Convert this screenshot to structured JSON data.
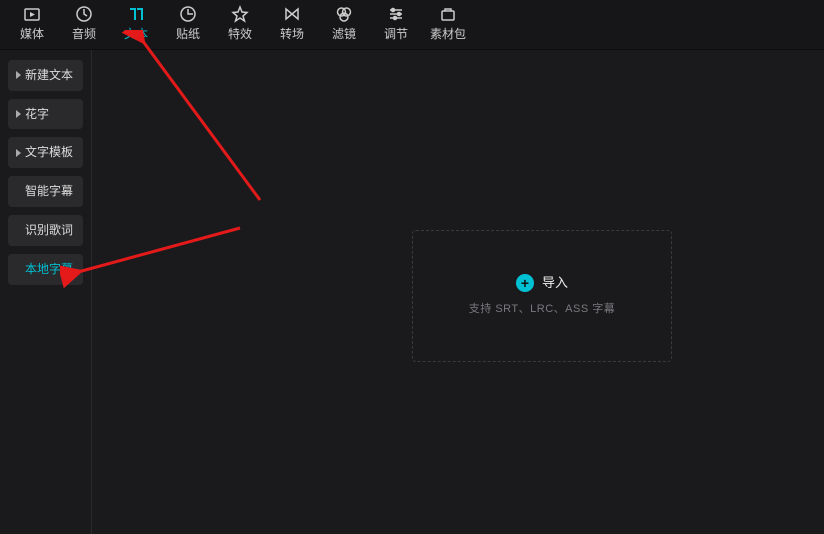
{
  "toolbar": [
    {
      "id": "media",
      "label": "媒体"
    },
    {
      "id": "audio",
      "label": "音频"
    },
    {
      "id": "text",
      "label": "文本",
      "active": true
    },
    {
      "id": "sticker",
      "label": "贴纸"
    },
    {
      "id": "effect",
      "label": "特效"
    },
    {
      "id": "transition",
      "label": "转场"
    },
    {
      "id": "filter",
      "label": "滤镜"
    },
    {
      "id": "adjust",
      "label": "调节"
    },
    {
      "id": "assets",
      "label": "素材包"
    }
  ],
  "sidebar": [
    {
      "id": "new-text",
      "label": "新建文本",
      "caret": true
    },
    {
      "id": "fancy-text",
      "label": "花字",
      "caret": true
    },
    {
      "id": "text-template",
      "label": "文字模板",
      "caret": true
    },
    {
      "id": "smart-subtitle",
      "label": "智能字幕",
      "caret": false
    },
    {
      "id": "lyrics",
      "label": "识别歌词",
      "caret": false
    },
    {
      "id": "local-subtitle",
      "label": "本地字幕",
      "caret": false,
      "active": true
    }
  ],
  "dropzone": {
    "title": "导入",
    "subtitle": "支持 SRT、LRC、ASS 字幕"
  }
}
